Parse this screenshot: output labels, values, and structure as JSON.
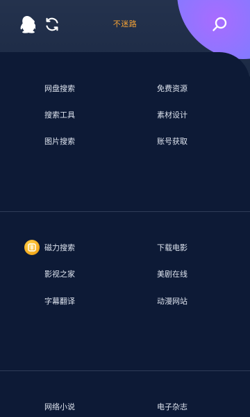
{
  "header": {
    "title": "不迷路",
    "left_icons": [
      "qq-penguin-icon",
      "refresh-icon"
    ],
    "right_icon": "search-icon"
  },
  "sections": [
    {
      "items": [
        {
          "label": "网盘搜索"
        },
        {
          "label": "免费资源"
        },
        {
          "label": "搜索工具"
        },
        {
          "label": "素材设计"
        },
        {
          "label": "图片搜索"
        },
        {
          "label": "账号获取"
        }
      ]
    },
    {
      "badge_icon": "magnet-coin-icon",
      "items": [
        {
          "label": "磁力搜索"
        },
        {
          "label": "下载电影"
        },
        {
          "label": "影视之家"
        },
        {
          "label": "美剧在线"
        },
        {
          "label": "字幕翻译"
        },
        {
          "label": "动漫网站"
        }
      ]
    },
    {
      "items": [
        {
          "label": "网络小说"
        },
        {
          "label": "电子杂志"
        }
      ]
    }
  ],
  "colors": {
    "background": "#0d1a36",
    "header": "#24324d",
    "accent_title": "#f4a235",
    "text": "#dde3ee"
  }
}
